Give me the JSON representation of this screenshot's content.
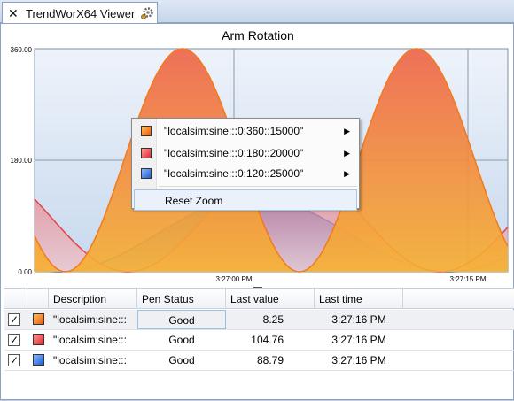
{
  "tab": {
    "title": "TrendWorX64 Viewer"
  },
  "chart_data": {
    "type": "area",
    "title": "Arm Rotation",
    "y_ticks": [
      "360.00",
      "180.00",
      "0.00"
    ],
    "x_ticks": [
      "3:27:00 PM",
      "3:27:15 PM"
    ],
    "ylim": [
      0,
      360
    ],
    "grid": true,
    "series": [
      {
        "name": "\"localsim:sine:::0:360::15000\"",
        "color": "#f07a1c",
        "min": 0,
        "max": 360,
        "period_s": 15
      },
      {
        "name": "\"localsim:sine:::0:180::20000\"",
        "color": "#e0454a",
        "min": 0,
        "max": 180,
        "period_s": 20
      },
      {
        "name": "\"localsim:sine:::0:120::25000\"",
        "color": "#2f73d8",
        "min": 0,
        "max": 120,
        "period_s": 25
      }
    ]
  },
  "context_menu": {
    "items": [
      {
        "label": "\"localsim:sine:::0:360::15000\"",
        "color": "#f07a1c"
      },
      {
        "label": "\"localsim:sine:::0:180::20000\"",
        "color": "#e0454a"
      },
      {
        "label": "\"localsim:sine:::0:120::25000\"",
        "color": "#2f73d8"
      }
    ],
    "reset_label": "Reset Zoom"
  },
  "grid": {
    "headers": {
      "description": "Description",
      "pen_status": "Pen Status",
      "last_value": "Last value",
      "last_time": "Last time"
    },
    "rows": [
      {
        "description": "\"localsim:sine:::",
        "status": "Good",
        "value": "8.25",
        "time": "3:27:16 PM",
        "color": "#f07a1c"
      },
      {
        "description": "\"localsim:sine:::",
        "status": "Good",
        "value": "104.76",
        "time": "3:27:16 PM",
        "color": "#e0454a"
      },
      {
        "description": "\"localsim:sine:::",
        "status": "Good",
        "value": "88.79",
        "time": "3:27:16 PM",
        "color": "#2f73d8"
      }
    ]
  }
}
